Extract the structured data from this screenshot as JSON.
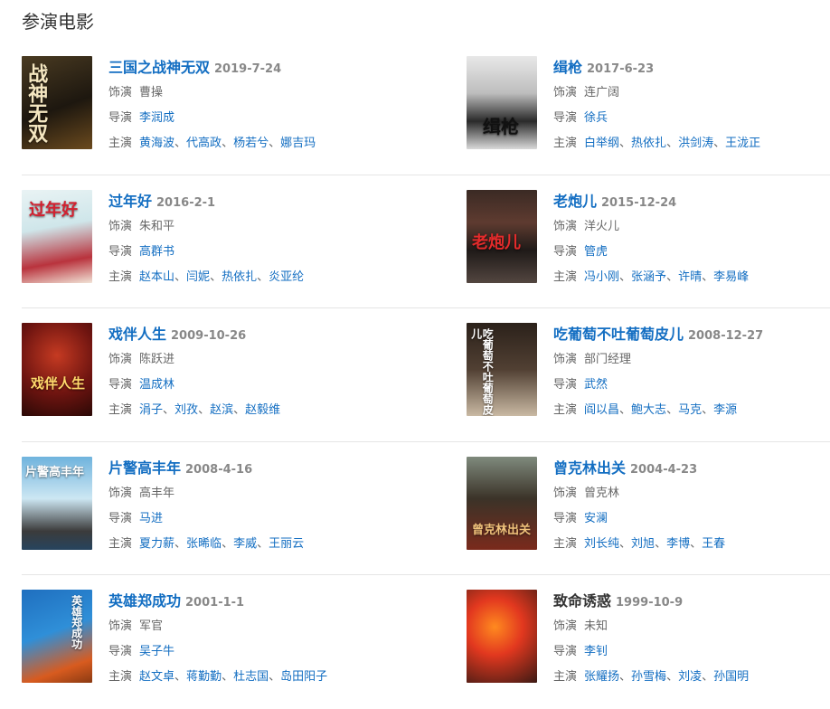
{
  "section_title": "参演电影",
  "labels": {
    "role": "饰演",
    "director": "导演",
    "cast": "主演",
    "sep": "、"
  },
  "colors": {
    "link": "#136ec2",
    "text": "#333333",
    "muted": "#888888",
    "divider": "#e5e5e5"
  },
  "movies": [
    {
      "title": "三国之战神无双",
      "date": "2019-7-24",
      "role": "曹操",
      "director": "李润成",
      "cast": [
        "黄海波",
        "代高政",
        "杨若兮",
        "娜吉玛"
      ],
      "poster_text": "战神无双",
      "title_linked": true
    },
    {
      "title": "缉枪",
      "date": "2017-6-23",
      "role": "连广阔",
      "director": "徐兵",
      "cast": [
        "白举纲",
        "热依扎",
        "洪剑涛",
        "王泷正"
      ],
      "poster_text": "缉枪",
      "title_linked": true
    },
    {
      "title": "过年好",
      "date": "2016-2-1",
      "role": "朱和平",
      "director": "高群书",
      "cast": [
        "赵本山",
        "闫妮",
        "热依扎",
        "炎亚纶"
      ],
      "poster_text": "过年好",
      "title_linked": true
    },
    {
      "title": "老炮儿",
      "date": "2015-12-24",
      "role": "洋火儿",
      "director": "管虎",
      "cast": [
        "冯小刚",
        "张涵予",
        "许晴",
        "李易峰"
      ],
      "poster_text": "老炮儿",
      "title_linked": true
    },
    {
      "title": "戏伴人生",
      "date": "2009-10-26",
      "role": "陈跃进",
      "director": "温成林",
      "cast": [
        "涓子",
        "刘孜",
        "赵滨",
        "赵毅维"
      ],
      "poster_text": "戏伴人生",
      "title_linked": true
    },
    {
      "title": "吃葡萄不吐葡萄皮儿",
      "date": "2008-12-27",
      "role": "部门经理",
      "director": "武然",
      "cast": [
        "阎以昌",
        "鲍大志",
        "马克",
        "李源"
      ],
      "poster_text": "吃葡萄不吐葡萄皮儿",
      "title_linked": true
    },
    {
      "title": "片警高丰年",
      "date": "2008-4-16",
      "role": "高丰年",
      "director": "马进",
      "cast": [
        "夏力薪",
        "张晞临",
        "李威",
        "王丽云"
      ],
      "poster_text": "片警高丰年",
      "title_linked": true
    },
    {
      "title": "曾克林出关",
      "date": "2004-4-23",
      "role": "曾克林",
      "director": "安澜",
      "cast": [
        "刘长纯",
        "刘旭",
        "李博",
        "王春"
      ],
      "poster_text": "曾克林出关",
      "title_linked": true
    },
    {
      "title": "英雄郑成功",
      "date": "2001-1-1",
      "role": "军官",
      "director": "吴子牛",
      "cast": [
        "赵文卓",
        "蒋勤勤",
        "杜志国",
        "岛田阳子"
      ],
      "poster_text": "英雄郑成功",
      "title_linked": true
    },
    {
      "title": "致命诱惑",
      "date": "1999-10-9",
      "role": "未知",
      "director": "李钊",
      "cast": [
        "张耀扬",
        "孙雪梅",
        "刘凌",
        "孙国明"
      ],
      "poster_text": "",
      "title_linked": false
    }
  ]
}
